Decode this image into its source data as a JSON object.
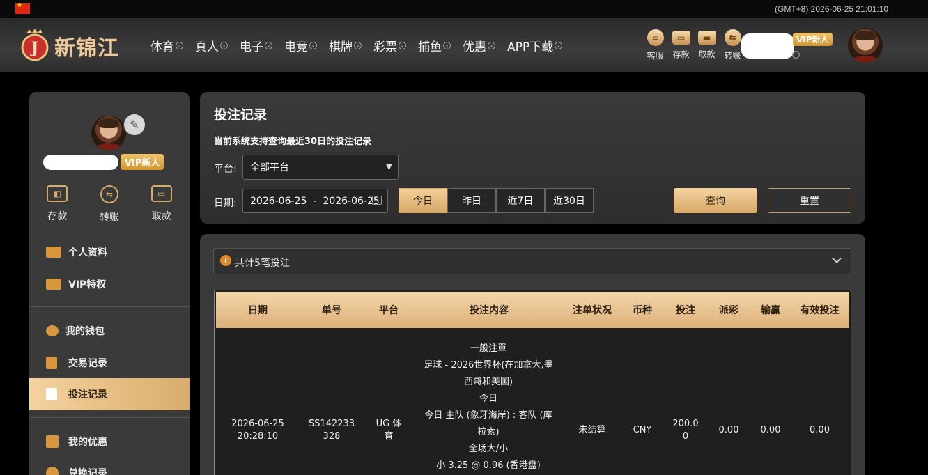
{
  "topbar": {
    "timezone_time": "(GMT+8) 2026-06-25 21:01:10",
    "flag": "china-flag"
  },
  "header": {
    "logo_text": "新锦江",
    "logo_letter": "J",
    "nav": [
      "体育",
      "真人",
      "电子",
      "电竞",
      "棋牌",
      "彩票",
      "捕鱼",
      "优惠",
      "APP下载"
    ],
    "tools": [
      {
        "label": "客服",
        "icon": "chat-icon"
      },
      {
        "label": "存款",
        "icon": "wallet-icon"
      },
      {
        "label": "取款",
        "icon": "briefcase-icon"
      },
      {
        "label": "转账",
        "icon": "transfer-icon"
      }
    ],
    "vip_badge": "VIP新人"
  },
  "sidebar": {
    "vip_badge": "VIP新人",
    "actions": [
      {
        "label": "存款",
        "icon": "wallet-icon"
      },
      {
        "label": "转账",
        "icon": "transfer-icon"
      },
      {
        "label": "取款",
        "icon": "card-icon"
      }
    ],
    "menu": [
      {
        "label": "个人资料",
        "icon": "profile-icon"
      },
      {
        "label": "VIP特权",
        "icon": "vip-icon"
      },
      {
        "label": "我的钱包",
        "icon": "piggy-bank-icon"
      },
      {
        "label": "交易记录",
        "icon": "ledger-icon"
      },
      {
        "label": "投注记录",
        "icon": "bet-record-icon"
      },
      {
        "label": "我的优惠",
        "icon": "gift-icon"
      },
      {
        "label": "兑换记录",
        "icon": "exchange-icon"
      }
    ]
  },
  "filter": {
    "title": "投注记录",
    "subtitle": "当前系统支持查询最近30日的投注记录",
    "platform_label": "平台:",
    "platform_value": "全部平台",
    "date_label": "日期:",
    "date_from": "2026-06-25",
    "date_sep": "-",
    "date_to": "2026-06-25",
    "ranges": [
      "今日",
      "昨日",
      "近7日",
      "近30日"
    ],
    "query_label": "查询",
    "reset_label": "重置"
  },
  "summary": {
    "text": "共计5笔投注"
  },
  "table": {
    "headers": [
      "日期",
      "单号",
      "平台",
      "投注内容",
      "注单状况",
      "币种",
      "投注",
      "派彩",
      "输赢",
      "有效投注"
    ],
    "row": {
      "date": "2026-06-25",
      "time": "20:28:10",
      "order_1": "SS142233",
      "order_2": "328",
      "platform_1": "UG 体",
      "platform_2": "育",
      "content": [
        "一般注單",
        "足球 - 2026世界杯(在加拿大,墨",
        "西哥和美国)",
        "今日",
        "今日 主队 (象牙海岸) : 客队 (库",
        "拉索)",
        "全场大/小",
        "小 3.25 @ 0.96 (香港盘)"
      ],
      "status": "未结算",
      "currency": "CNY",
      "stake_1": "200.0",
      "stake_2": "0",
      "payout": "0.00",
      "winloss": "0.00",
      "valid": "0.00"
    }
  }
}
